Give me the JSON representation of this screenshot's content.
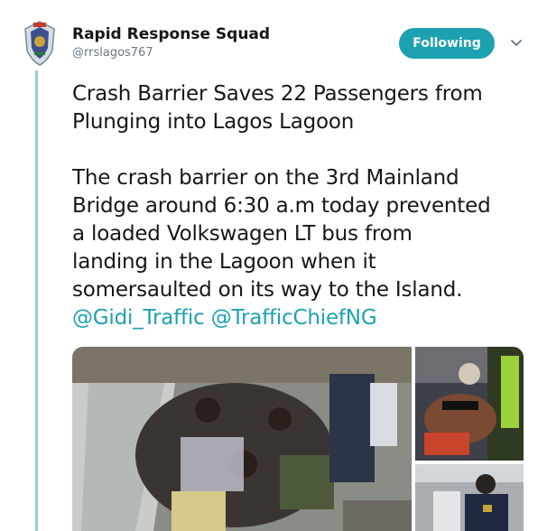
{
  "account": {
    "name": "Rapid Response Squad",
    "handle": "@rrslagos767",
    "avatar_icon": "police-badge-icon"
  },
  "follow_button": {
    "label": "Following",
    "color": "#1da1b1"
  },
  "menu_icon": "chevron-down-icon",
  "tweet": {
    "headline_line1": "Crash Barrier Saves 22 Passengers from",
    "headline_line2": "Plunging into Lagos Lagoon",
    "body_line1": "The crash barrier on the 3rd Mainland",
    "body_line2": "Bridge around 6:30 a.m today prevented",
    "body_line3": "a loaded Volkswagen LT bus from",
    "body_line4": "landing in the Lagoon when it",
    "body_line5": "somersaulted on its way to the Island.",
    "mention1": "@Gidi_Traffic",
    "mention2": "@TrafficChiefNG",
    "mention_color": "#1da1b1"
  },
  "media": {
    "photos": [
      {
        "subject": "passengers seated on bridge beside crash barrier"
      },
      {
        "subject": "responders attending injured person"
      },
      {
        "subject": "officer on bridge"
      }
    ]
  },
  "colors": {
    "thread_line": "#8ecfd9",
    "text": "#14171a",
    "secondary_text": "#657786"
  }
}
